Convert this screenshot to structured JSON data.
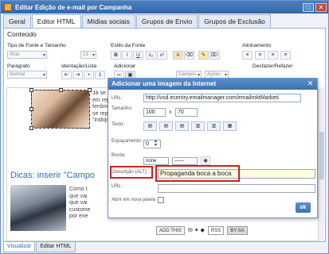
{
  "window": {
    "title": "Editar Edição de e-mail por Campanha"
  },
  "tabs": [
    "Geral",
    "Editor HTML",
    "Mídias sociais",
    "Grupos de Envio",
    "Grupos de Exclusão"
  ],
  "section_title": "Conteúdo",
  "toolbar": {
    "font_label": "Tipo de Fonte e Tamanho",
    "font_value": "Arial",
    "size_value": "13",
    "style_label": "Estilo da Fonte",
    "align_label": "Alinhamento",
    "paragraph_label": "Parágrafo",
    "paragraph_value": "Normal",
    "indent_label": "Identação/Lista",
    "add_label": "Adicionar",
    "undo_label": "Desfazer/Refazer",
    "campos_value": "Campos",
    "acoes_value": "Ações",
    "bold": "B",
    "italic": "I",
    "underline": "U",
    "subscript": "x₂",
    "superscript": "x²"
  },
  "editor": {
    "para1": [
      "Já se de",
      "em repe",
      "fenômer",
      "se repet",
      "\"indique"
    ],
    "dicas_title": "Dicas: inserir \"Campo",
    "para2": [
      "Como t",
      "que vai",
      "que vai",
      "custome",
      "por exe"
    ]
  },
  "footer": {
    "addthis": "ADD THIS",
    "rss": "RSS",
    "cc": "BY-SA"
  },
  "bottom_tabs": [
    "Visualizar",
    "Editar HTML"
  ],
  "dialog": {
    "title": "Adicionar uma imagem da Internet",
    "url_label": "URL:",
    "url_value": "http://vsd.ecentry.emailmanager.com/emailmktMarketi",
    "size_label": "Tamanho:",
    "width_value": "100",
    "x_sep": "x",
    "height_value": "70",
    "text_label": "Texto:",
    "spacing_label": "Espaçamento:",
    "spacing_value": "0",
    "border_label": "Borda:",
    "border_value": "none",
    "alt_label": "Descrição (ALT):",
    "alt_value": "Propaganda boca a boca",
    "link_url_label": "URL:",
    "link_url_value": "",
    "new_window_label": "Abrir em nova janela",
    "ok_label": "ok"
  }
}
